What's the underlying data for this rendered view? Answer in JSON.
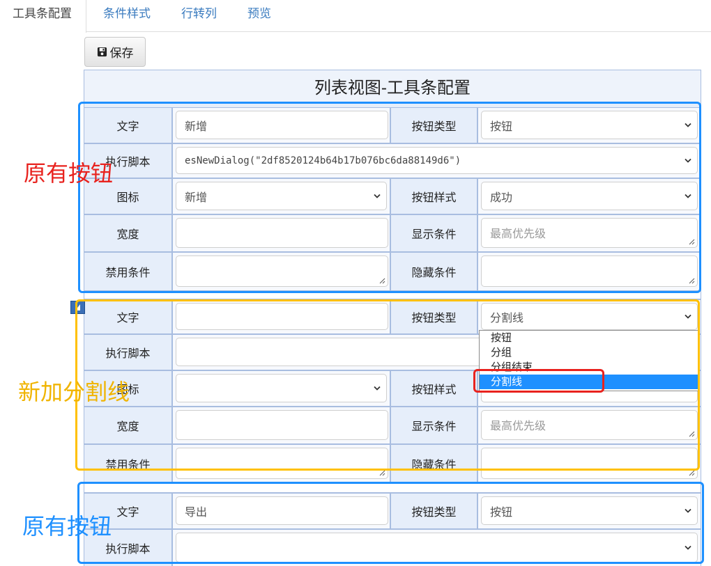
{
  "tabs": [
    "工具条配置",
    "条件样式",
    "行转列",
    "预览"
  ],
  "toolbar": {
    "save_label": "保存"
  },
  "form": {
    "title": "列表视图-工具条配置",
    "labels": {
      "text": "文字",
      "button_type": "按钮类型",
      "script": "执行脚本",
      "icon": "图标",
      "button_style": "按钮样式",
      "width": "宽度",
      "display_condition": "显示条件",
      "disable_condition": "禁用条件",
      "hide_condition": "隐藏条件"
    },
    "placeholders": {
      "display_condition": "最高优先级"
    },
    "blocks": [
      {
        "text": "新增",
        "button_type": "按钮",
        "script": "esNewDialog(\"2df8520124b64b17b076bc6da88149d6\")",
        "icon": "新增",
        "button_style": "成功"
      },
      {
        "text": "",
        "button_type": "分割线",
        "script": "",
        "icon": "",
        "button_style": ""
      },
      {
        "text": "导出",
        "button_type": "按钮",
        "script": ""
      }
    ],
    "dropdown_options": [
      "按钮",
      "分组",
      "分组结束",
      "分割线"
    ],
    "dropdown_selected": "分割线"
  },
  "annotations": {
    "original_button_top": "原有按钮",
    "new_divider": "新加分割线",
    "original_button_bottom": "原有按钮"
  },
  "colors": {
    "blue_box": "#1e90ff",
    "yellow_box": "#ffc000",
    "red_box": "#e8221e",
    "red_text": "#e8221e",
    "yellow_text": "#f0b400",
    "blue_text": "#1e90ff"
  }
}
